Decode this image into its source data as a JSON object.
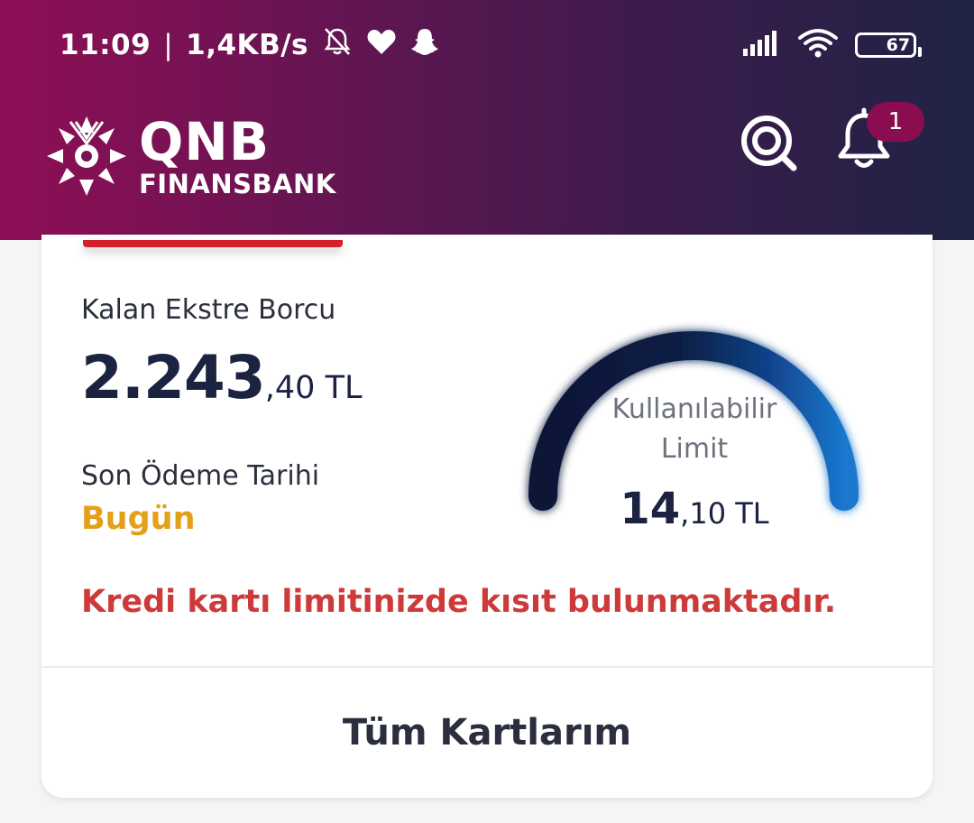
{
  "status_bar": {
    "time": "11:09",
    "separator": "|",
    "network_speed": "1,4KB/s",
    "icons_left": [
      "bell-off-icon",
      "heart-icon",
      "snapchat-icon"
    ],
    "icons_right": [
      "signal-icon",
      "wifi-icon",
      "battery-icon"
    ],
    "battery_level": "67"
  },
  "header": {
    "brand_line1": "QNB",
    "brand_line2": "FINANSBANK",
    "search_icon": "search-icon",
    "notification_icon": "bell-icon",
    "notification_count": "1"
  },
  "card": {
    "debt_label": "Kalan Ekstre Borcu",
    "debt_amount_integer": "2.243",
    "debt_amount_decimal": ",40",
    "debt_currency": " TL",
    "due_label": "Son Ödeme Tarihi",
    "due_value": "Bugün",
    "gauge_label_line1": "Kullanılabilir",
    "gauge_label_line2": "Limit",
    "limit_integer": "14",
    "limit_decimal": ",10",
    "limit_currency": " TL",
    "warning": "Kredi kartı limitinizde kısıt bulunmaktadır.",
    "all_cards_button": "Tüm Kartlarım"
  },
  "colors": {
    "header_start": "#8f0e55",
    "header_end": "#1f2344",
    "due_value": "#e3a019",
    "warning": "#cd3a3a",
    "amount_text": "#1c2340",
    "badge": "#8a0d4f"
  }
}
